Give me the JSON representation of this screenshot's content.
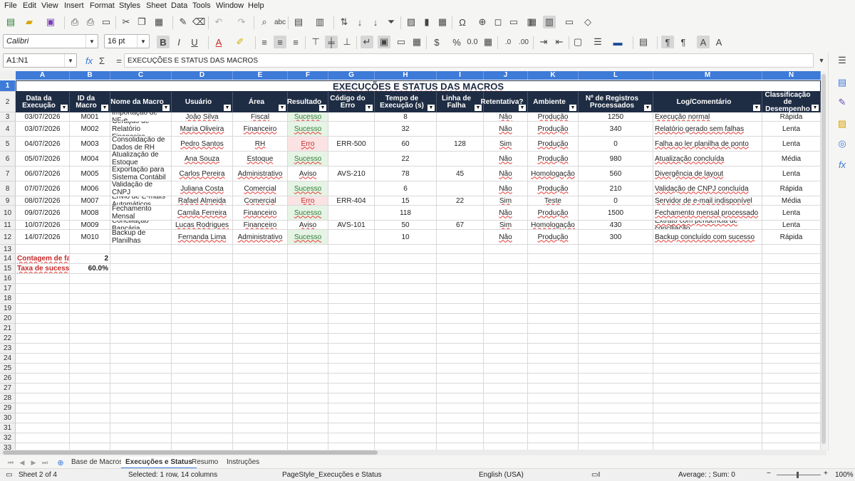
{
  "menu": [
    "File",
    "Edit",
    "View",
    "Insert",
    "Format",
    "Styles",
    "Sheet",
    "Data",
    "Tools",
    "Window",
    "Help"
  ],
  "toolbar": {
    "font_name": "Calibri",
    "font_size": "16 pt"
  },
  "formula_bar": {
    "cell_ref": "A1:N1",
    "content": "EXECUÇÕES E STATUS DAS MACROS"
  },
  "columns": [
    "A",
    "B",
    "C",
    "D",
    "E",
    "F",
    "G",
    "H",
    "I",
    "J",
    "K",
    "L",
    "M",
    "N"
  ],
  "rows": [
    "1",
    "2",
    "3",
    "4",
    "5",
    "6",
    "7",
    "8",
    "9",
    "10",
    "11",
    "12",
    "13",
    "14",
    "15",
    "16",
    "17",
    "18",
    "19",
    "20",
    "21",
    "22",
    "23",
    "24",
    "25",
    "26",
    "27",
    "28",
    "29",
    "30",
    "31",
    "32",
    "33"
  ],
  "sheet_title": "EXECUÇÕES E STATUS DAS MACROS",
  "headers": [
    "Data da Execução",
    "ID da Macro",
    "Nome da Macro",
    "Usuário",
    "Área",
    "Resultado",
    "Código do Erro",
    "Tempo de Execução (s)",
    "Linha de Falha",
    "Retentativa?",
    "Ambiente",
    "Nº de Registros Processados",
    "Log/Comentário",
    "Classificação de Desempenho"
  ],
  "data_rows": [
    [
      "03/07/2026",
      "M001",
      "Importação de NF-e",
      "João Silva",
      "Fiscal",
      "Sucesso",
      "",
      "8",
      "",
      "Não",
      "Produção",
      "1250",
      "Execução normal",
      "Rápida"
    ],
    [
      "03/07/2026",
      "M002",
      "Geração de Relatório Financeiro",
      "Maria Oliveira",
      "Financeiro",
      "Sucesso",
      "",
      "32",
      "",
      "Não",
      "Produção",
      "340",
      "Relatório gerado sem falhas",
      "Lenta"
    ],
    [
      "04/07/2026",
      "M003",
      "Consolidação de Dados de RH",
      "Pedro Santos",
      "RH",
      "Erro",
      "ERR-500",
      "60",
      "128",
      "Sim",
      "Produção",
      "0",
      "Falha ao ler planilha de ponto",
      "Lenta"
    ],
    [
      "05/07/2026",
      "M004",
      "Atualização de Estoque",
      "Ana Souza",
      "Estoque",
      "Sucesso",
      "",
      "22",
      "",
      "Não",
      "Produção",
      "980",
      "Atualização concluída",
      "Média"
    ],
    [
      "06/07/2026",
      "M005",
      "Exportação para Sistema Contábil",
      "Carlos Pereira",
      "Administrativo",
      "Aviso",
      "AVS-210",
      "78",
      "45",
      "Não",
      "Homologação",
      "560",
      "Divergência de layout",
      "Lenta"
    ],
    [
      "07/07/2026",
      "M006",
      "Validação de CNPJ",
      "Juliana Costa",
      "Comercial",
      "Sucesso",
      "",
      "6",
      "",
      "Não",
      "Produção",
      "210",
      "Validação de CNPJ concluída",
      "Rápida"
    ],
    [
      "08/07/2026",
      "M007",
      "Envio de E-mails Automáticos",
      "Rafael Almeida",
      "Comercial",
      "Erro",
      "ERR-404",
      "15",
      "22",
      "Sim",
      "Teste",
      "0",
      "Servidor de e-mail indisponível",
      "Média"
    ],
    [
      "09/07/2026",
      "M008",
      "Fechamento Mensal",
      "Camila Ferreira",
      "Financeiro",
      "Sucesso",
      "",
      "118",
      "",
      "Não",
      "Produção",
      "1500",
      "Fechamento mensal processado",
      "Lenta"
    ],
    [
      "10/07/2026",
      "M009",
      "Conciliação Bancária",
      "Lucas Rodrigues",
      "Financeiro",
      "Aviso",
      "AVS-101",
      "50",
      "67",
      "Sim",
      "Homologação",
      "430",
      "Extrato com pendência de conciliação",
      "Lenta"
    ],
    [
      "14/07/2026",
      "M010",
      "Backup de Planilhas",
      "Fernanda Lima",
      "Administrativo",
      "Sucesso",
      "",
      "10",
      "",
      "Não",
      "Produção",
      "300",
      "Backup concluído com sucesso",
      "Rápida"
    ]
  ],
  "summary": {
    "fail_label": "Contagem de falh",
    "fail_value": "2",
    "rate_label": "Taxa de sucesso:",
    "rate_value": "60.0%"
  },
  "tabs": [
    "Base de Macros",
    "Execuções e Status",
    "Resumo",
    "Instruções"
  ],
  "active_tab": "Execuções e Status",
  "status_bar": {
    "sheet": "Sheet 2 of 4",
    "selection": "Selected: 1 row, 14 columns",
    "page_style": "PageStyle_Execuções e Status",
    "language": "English (USA)",
    "stats": "Average: ; Sum: 0",
    "zoom": "100%"
  },
  "colors": {
    "header_blue": "#3e7ad8",
    "table_header": "#1f2d44",
    "success": "#2e7d32",
    "error": "#c62828"
  }
}
